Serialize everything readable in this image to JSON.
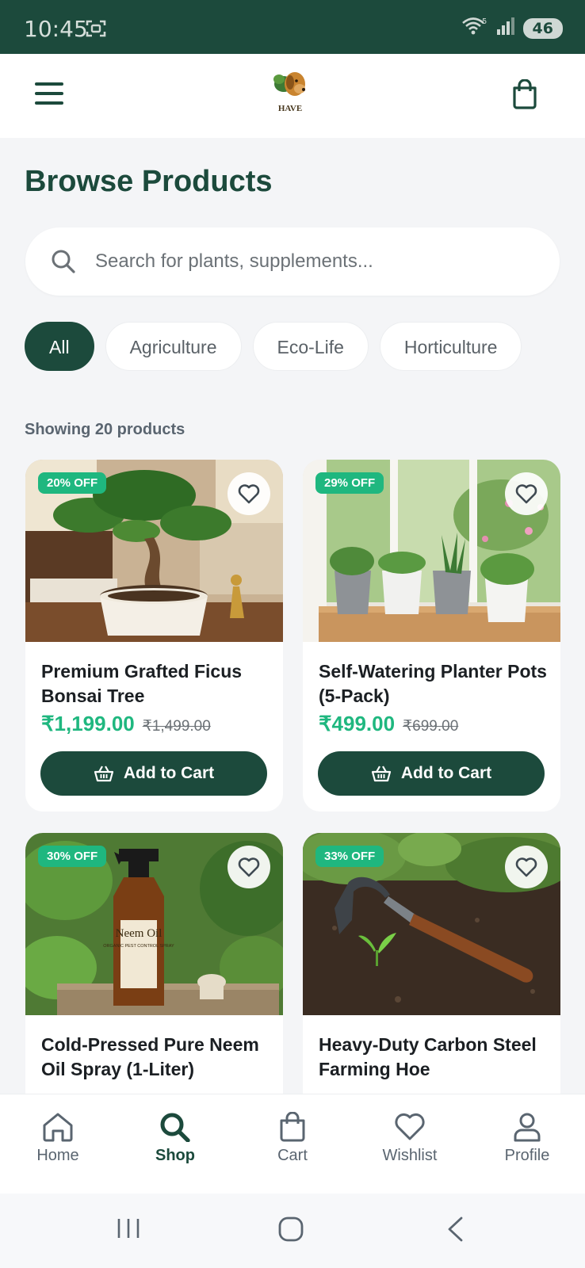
{
  "status_bar": {
    "time": "10:45",
    "battery": "46"
  },
  "header": {
    "logo_text": "HAVE"
  },
  "page": {
    "title": "Browse Products",
    "showing_count": "Showing 20 products"
  },
  "search": {
    "placeholder": "Search for plants, supplements..."
  },
  "categories": [
    {
      "label": "All",
      "active": true
    },
    {
      "label": "Agriculture",
      "active": false
    },
    {
      "label": "Eco-Life",
      "active": false
    },
    {
      "label": "Horticulture",
      "active": false
    }
  ],
  "products": [
    {
      "discount": "20% OFF",
      "name": "Premium Grafted Ficus Bonsai Tree",
      "price": "₹1,199.00",
      "old_price": "₹1,499.00",
      "cta": "Add to Cart"
    },
    {
      "discount": "29% OFF",
      "name": "Self-Watering Planter Pots (5-Pack)",
      "price": "₹499.00",
      "old_price": "₹699.00",
      "cta": "Add to Cart"
    },
    {
      "discount": "30% OFF",
      "name": "Cold-Pressed Pure Neem Oil Spray (1-Liter)",
      "label_text": "Neem Oil",
      "label_sub": "ORGANIC PEST CONTROL SPRAY"
    },
    {
      "discount": "33% OFF",
      "name": "Heavy-Duty Carbon Steel Farming Hoe"
    }
  ],
  "bottom_nav": [
    {
      "label": "Home",
      "icon": "home-icon",
      "active": false
    },
    {
      "label": "Shop",
      "icon": "search-icon",
      "active": true
    },
    {
      "label": "Cart",
      "icon": "bag-icon",
      "active": false
    },
    {
      "label": "Wishlist",
      "icon": "heart-icon",
      "active": false
    },
    {
      "label": "Profile",
      "icon": "user-icon",
      "active": false
    }
  ],
  "colors": {
    "primary": "#1c4a3c",
    "accent": "#1fb77f",
    "background": "#f4f5f7"
  }
}
